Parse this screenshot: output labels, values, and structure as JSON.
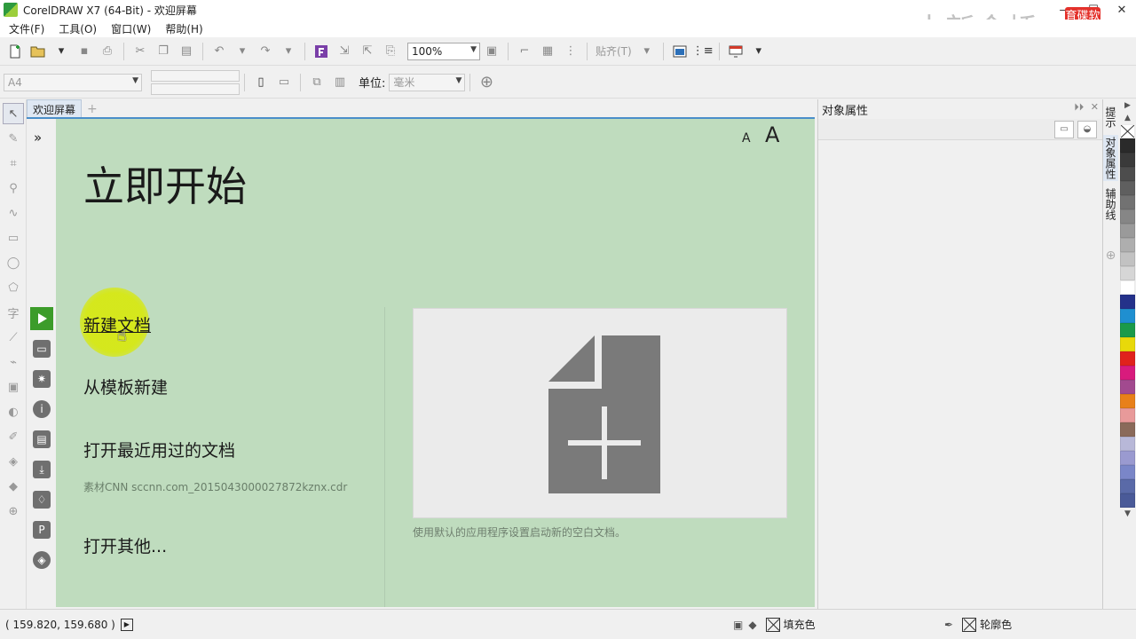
{
  "window": {
    "title": "CorelDRAW X7 (64-Bit) - 欢迎屏幕",
    "controls": [
      "—",
      "☐",
      "✕"
    ]
  },
  "watermark": {
    "text": "中新金桥",
    "logo": "育碟软件"
  },
  "menu": [
    {
      "label": "文件(F)"
    },
    {
      "label": "工具(O)"
    },
    {
      "label": "窗口(W)"
    },
    {
      "label": "帮助(H)"
    }
  ],
  "toolbar": {
    "zoom": "100%",
    "snap": "贴齐(T)"
  },
  "propbar": {
    "page_size": "A4",
    "unit_label": "单位:",
    "unit_value": "毫米"
  },
  "doc_tab": {
    "label": "欢迎屏幕",
    "add": "+"
  },
  "welcome": {
    "expander": "»",
    "title": "立即开始",
    "font_small": "A",
    "font_large": "A",
    "links": {
      "new_doc": "新建文档",
      "from_template": "从模板新建",
      "open_recent": "打开最近用过的文档",
      "recent_file": "素材CNN sccnn.com_20150430000278​72kznx.cdr",
      "open_other": "打开其他..."
    },
    "preview_desc": "使用默认的应用程序设置启动新的空白文档。"
  },
  "docker": {
    "title": "对象属性",
    "vtabs": [
      "提示",
      "对象属性",
      "辅助线"
    ]
  },
  "palette": [
    "#2a2a2a",
    "#3a3a3a",
    "#4d4d4d",
    "#5f5f5f",
    "#727272",
    "#868686",
    "#9a9a9a",
    "#aeaeae",
    "#c2c2c2",
    "#d6d6d6",
    "#ffffff",
    "#24318a",
    "#1f8fd0",
    "#1a9a4a",
    "#e8d90a",
    "#e0221c",
    "#d81b7d",
    "#a24a8f",
    "#e8801a",
    "#e89a9a",
    "#8a6a5a",
    "#b8b8d8",
    "#9a9ad0",
    "#7a86c8",
    "#5a6aa8",
    "#4a5a98"
  ],
  "status": {
    "coords": "( 159.820, 159.680 )",
    "fill_label": "填充色",
    "outline_label": "轮廓色"
  }
}
